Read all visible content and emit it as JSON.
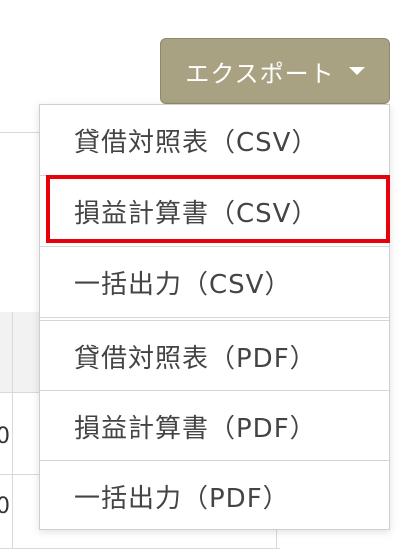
{
  "export_button": {
    "label": "エクスポート"
  },
  "menu": {
    "items": [
      {
        "label": "貸借対照表（CSV）"
      },
      {
        "label": "損益計算書（CSV）"
      },
      {
        "label": "一括出力（CSV）"
      },
      {
        "label": "貸借対照表（PDF）"
      },
      {
        "label": "損益計算書（PDF）"
      },
      {
        "label": "一括出力（PDF）"
      }
    ],
    "highlighted_index": 1
  },
  "background": {
    "digits": [
      "0",
      "0"
    ]
  },
  "colors": {
    "button_bg": "#a8a283",
    "highlight_border": "#e8000b",
    "menu_text": "#444444"
  }
}
